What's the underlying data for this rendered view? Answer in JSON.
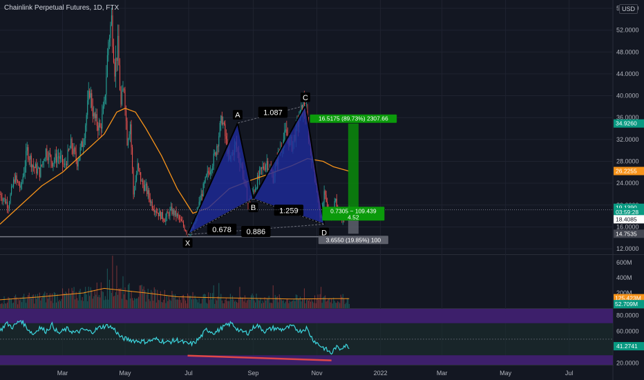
{
  "header": {
    "title": "Chainlink Perpetual Futures, 1D, FTX",
    "currency": "USD"
  },
  "colors": {
    "background": "#131722",
    "up": "#26a69a",
    "down": "#ef5350",
    "ma": "#f7931a",
    "pattern_fill": "#1e2a9c",
    "pattern_edge": "#000000",
    "profit": "#0b8a0b",
    "stop": "#5d606b",
    "rsi": "#3dd8e0",
    "rsi_band": "#3d1f6b",
    "divergence": "#e04848"
  },
  "chart_data": [
    {
      "type": "candlestick",
      "title": "Chainlink Perpetual Futures, 1D, FTX",
      "y_axis": {
        "ticks": [
          "56.0000",
          "52.0000",
          "48.0000",
          "44.0000",
          "40.0000",
          "36.0000",
          "32.0000",
          "28.0000",
          "24.0000",
          "20.0000",
          "16.0000",
          "12.0000"
        ],
        "range": [
          11.0,
          56.5
        ]
      },
      "x_axis": {
        "ticks": [
          "Mar",
          "May",
          "Jul",
          "Sep",
          "Nov",
          "2022",
          "Mar",
          "May",
          "Jul"
        ]
      },
      "x_domain": [
        0,
        588
      ],
      "x_tick_positions": [
        60,
        120,
        181,
        243,
        304,
        365,
        424,
        485,
        546
      ],
      "last_bar": 335,
      "path": [
        [
          0,
          22
        ],
        [
          8,
          20
        ],
        [
          14,
          25
        ],
        [
          20,
          23
        ],
        [
          26,
          30
        ],
        [
          32,
          27
        ],
        [
          38,
          26
        ],
        [
          44,
          30
        ],
        [
          50,
          28
        ],
        [
          56,
          29
        ],
        [
          62,
          27
        ],
        [
          68,
          31
        ],
        [
          74,
          28
        ],
        [
          80,
          32
        ],
        [
          86,
          41
        ],
        [
          90,
          36
        ],
        [
          96,
          34
        ],
        [
          100,
          38
        ],
        [
          104,
          50
        ],
        [
          107,
          54
        ],
        [
          110,
          45
        ],
        [
          113,
          49
        ],
        [
          116,
          38
        ],
        [
          119,
          42
        ],
        [
          122,
          32
        ],
        [
          125,
          35
        ],
        [
          128,
          22
        ],
        [
          132,
          27
        ],
        [
          136,
          24
        ],
        [
          140,
          23
        ],
        [
          146,
          20
        ],
        [
          152,
          18.5
        ],
        [
          158,
          17.5
        ],
        [
          164,
          19
        ],
        [
          170,
          18
        ],
        [
          175,
          16.5
        ],
        [
          180,
          14.9
        ],
        [
          186,
          16
        ],
        [
          192,
          21
        ],
        [
          198,
          25
        ],
        [
          206,
          29
        ],
        [
          213,
          36
        ],
        [
          220,
          28
        ],
        [
          226,
          31
        ],
        [
          232,
          27
        ],
        [
          238,
          20.2
        ],
        [
          244,
          23
        ],
        [
          250,
          26
        ],
        [
          256,
          28
        ],
        [
          262,
          25
        ],
        [
          268,
          30
        ],
        [
          274,
          33
        ],
        [
          280,
          31
        ],
        [
          286,
          35
        ],
        [
          291,
          38.4
        ],
        [
          294,
          36
        ],
        [
          298,
          30
        ],
        [
          302,
          26
        ],
        [
          305,
          21
        ],
        [
          308,
          17
        ],
        [
          311,
          23
        ],
        [
          314,
          19
        ],
        [
          318,
          17.8
        ],
        [
          322,
          21
        ],
        [
          326,
          18
        ],
        [
          330,
          17.3
        ],
        [
          335,
          19.1
        ]
      ],
      "series": [
        {
          "name": "",
          "type": "moving_average",
          "color": "#f7931a",
          "values": [
            [
              0,
              16.5
            ],
            [
              20,
              20
            ],
            [
              40,
              23.5
            ],
            [
              60,
              26
            ],
            [
              80,
              29.5
            ],
            [
              100,
              33
            ],
            [
              112,
              37
            ],
            [
              120,
              37.7
            ],
            [
              130,
              37
            ],
            [
              140,
              34
            ],
            [
              155,
              29
            ],
            [
              170,
              23
            ],
            [
              185,
              18.5
            ],
            [
              200,
              19.5
            ],
            [
              220,
              23
            ],
            [
              240,
              24.5
            ],
            [
              260,
              25.8
            ],
            [
              280,
              27.2
            ],
            [
              295,
              28.5
            ],
            [
              310,
              28
            ],
            [
              320,
              27
            ],
            [
              335,
              26.2
            ]
          ]
        }
      ],
      "annotations": {
        "xabcd": {
          "points": [
            {
              "name": "X",
              "x": 180,
              "price": 14.6
            },
            {
              "name": "A",
              "x": 228,
              "price": 35.0
            },
            {
              "name": "B",
              "x": 243,
              "price": 21.1
            },
            {
              "name": "C",
              "x": 293,
              "price": 38.2
            },
            {
              "name": "D",
              "x": 311,
              "price": 16.5
            }
          ],
          "ratios": {
            "xb": "0.678",
            "ac": "1.087",
            "bd": "1.259",
            "xd": "0.886"
          }
        },
        "position": {
          "entry": 18.8,
          "target": 34.926,
          "stop": 14.7535,
          "x_start": 334,
          "x_end": 344,
          "target_label": "16.5175 (89.73%) 2307.66",
          "entry_label_1": "0.7305 ~ 109.439",
          "entry_label_2": "4.52",
          "stop_label": "3.6550 (19.85%) 100"
        },
        "horizontal_line": 14.2
      },
      "price_tags": [
        {
          "text": "34.9260",
          "price": 34.926,
          "bg": "#089981",
          "fg": "#ffffff"
        },
        {
          "text": "26.2255",
          "price": 26.2255,
          "bg": "#f7931a",
          "fg": "#ffffff"
        },
        {
          "text": "19.1390",
          "price": 19.5,
          "bg": "#089981",
          "fg": "#ffffff"
        },
        {
          "text": "03:59:28",
          "price": 18.7,
          "bg": "#089981",
          "fg": "#ffffff"
        },
        {
          "text": "18.4085",
          "price": 17.4,
          "bg": "#ffffff",
          "fg": "#131722"
        },
        {
          "text": "14.7535",
          "price": 14.7535,
          "bg": "#434651",
          "fg": "#ffffff"
        }
      ]
    },
    {
      "type": "bar",
      "title": "",
      "y_axis": {
        "ticks": [
          "600M",
          "400M",
          "200M"
        ],
        "range": [
          0,
          700
        ]
      },
      "ma": [
        [
          0,
          110
        ],
        [
          40,
          150
        ],
        [
          80,
          200
        ],
        [
          100,
          260
        ],
        [
          120,
          230
        ],
        [
          140,
          200
        ],
        [
          170,
          150
        ],
        [
          200,
          140
        ],
        [
          240,
          130
        ],
        [
          280,
          120
        ],
        [
          320,
          125
        ],
        [
          335,
          125
        ]
      ],
      "spikes": [
        [
          103,
          520
        ],
        [
          108,
          690
        ],
        [
          112,
          560
        ],
        [
          118,
          420
        ],
        [
          205,
          300
        ],
        [
          210,
          330
        ],
        [
          230,
          280
        ],
        [
          262,
          300
        ],
        [
          292,
          260
        ],
        [
          308,
          280
        ]
      ],
      "price_tags": [
        {
          "text": "125.423M",
          "value": 131,
          "bg": "#f7931a",
          "fg": "#ffffff"
        },
        {
          "text": "52.709M",
          "value": 53,
          "bg": "#089981",
          "fg": "#ffffff"
        }
      ]
    },
    {
      "type": "line",
      "title": "",
      "y_axis": {
        "ticks": [
          "80.0000",
          "60.0000",
          "40.0000",
          "20.0000"
        ],
        "range": [
          18,
          88
        ]
      },
      "upper": 70,
      "lower": 30,
      "path": [
        [
          0,
          60
        ],
        [
          6,
          70
        ],
        [
          12,
          65
        ],
        [
          20,
          74
        ],
        [
          26,
          64
        ],
        [
          32,
          56
        ],
        [
          38,
          65
        ],
        [
          44,
          60
        ],
        [
          50,
          68
        ],
        [
          56,
          57
        ],
        [
          64,
          63
        ],
        [
          72,
          58
        ],
        [
          80,
          62
        ],
        [
          88,
          59
        ],
        [
          96,
          65
        ],
        [
          104,
          67
        ],
        [
          110,
          62
        ],
        [
          116,
          52
        ],
        [
          122,
          50
        ],
        [
          130,
          48
        ],
        [
          140,
          47
        ],
        [
          150,
          50
        ],
        [
          160,
          46
        ],
        [
          170,
          49
        ],
        [
          180,
          44
        ],
        [
          186,
          45
        ],
        [
          192,
          52
        ],
        [
          198,
          62
        ],
        [
          206,
          58
        ],
        [
          214,
          65
        ],
        [
          222,
          70
        ],
        [
          230,
          60
        ],
        [
          238,
          58
        ],
        [
          246,
          68
        ],
        [
          254,
          60
        ],
        [
          262,
          64
        ],
        [
          270,
          62
        ],
        [
          280,
          66
        ],
        [
          288,
          60
        ],
        [
          294,
          64
        ],
        [
          300,
          50
        ],
        [
          306,
          43
        ],
        [
          312,
          38
        ],
        [
          318,
          32
        ],
        [
          322,
          40
        ],
        [
          326,
          38
        ],
        [
          330,
          42
        ],
        [
          335,
          41
        ]
      ],
      "divergence": [
        [
          180,
          29.5
        ],
        [
          318,
          23.5
        ]
      ],
      "price_tags": [
        {
          "text": "41.2741",
          "value": 41.27,
          "bg": "#089981",
          "fg": "#ffffff"
        }
      ]
    }
  ]
}
